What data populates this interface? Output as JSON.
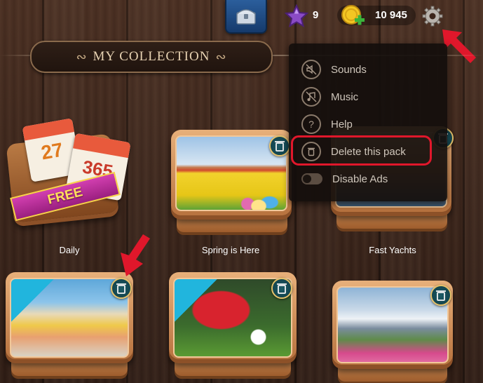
{
  "header": {
    "stars": "9",
    "coins": "10 945",
    "title": "MY COLLECTION"
  },
  "menu": {
    "items": [
      {
        "label": "Sounds",
        "icon": "sound-off-icon"
      },
      {
        "label": "Music",
        "icon": "music-off-icon"
      },
      {
        "label": "Help",
        "icon": "help-icon"
      },
      {
        "label": "Delete this pack",
        "icon": "trash-icon"
      },
      {
        "label": "Disable Ads",
        "icon": "toggle-icon"
      }
    ]
  },
  "packs": [
    {
      "label": "Daily",
      "badge": "FREE",
      "calendar_left": "27",
      "calendar_right": "365"
    },
    {
      "label": "Spring is Here"
    },
    {
      "label": "Fast Yachts"
    },
    {
      "label": ""
    },
    {
      "label": ""
    },
    {
      "label": ""
    }
  ],
  "colors": {
    "highlight": "#e0172b",
    "arrow": "#e0172b",
    "frame": "#d8955a",
    "trash_badge": "#0e3b45"
  }
}
